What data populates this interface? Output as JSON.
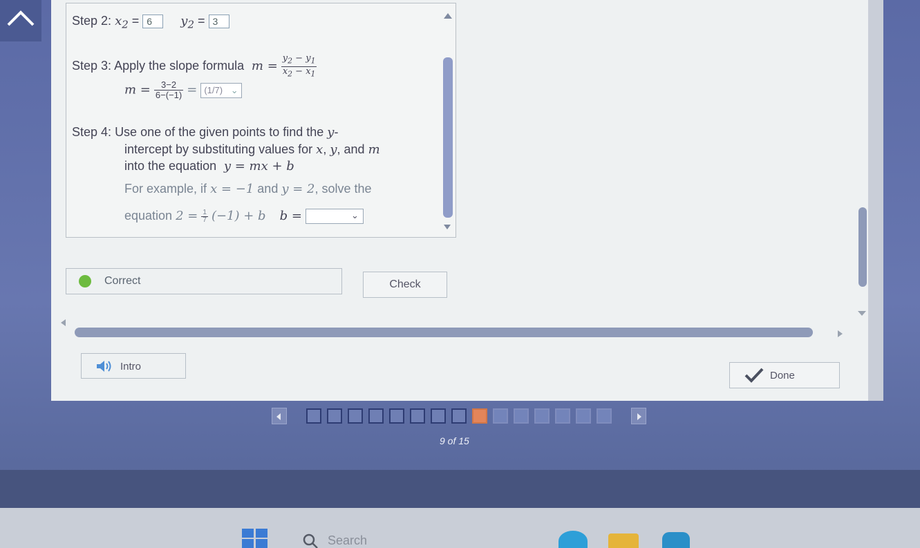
{
  "step2": {
    "label": "Step 2:",
    "x2_value": "6",
    "y2_value": "3"
  },
  "step3": {
    "label": "Step 3:",
    "text": "Apply the slope formula",
    "calc_num": "3−2",
    "calc_den": "6−(−1)",
    "answer_dropdown": "(1/7)"
  },
  "step4": {
    "label": "Step 4:",
    "line1": "Use one of the given points to find the",
    "line1_var": "y",
    "line2": "intercept by substituting values for",
    "line3": "into the equation",
    "example_line": "For example, if",
    "example_x": "x = −1",
    "example_and": "and",
    "example_y": "y = 2",
    "example_solve": ", solve the",
    "equation_label": "equation",
    "b_label": "b ="
  },
  "feedback": {
    "status": "Correct",
    "check_label": "Check"
  },
  "nav": {
    "intro_label": "Intro",
    "done_label": "Done"
  },
  "pagination": {
    "current": 9,
    "total": 15,
    "label": "9 of 15"
  },
  "taskbar": {
    "search_placeholder": "Search"
  },
  "colors": {
    "accent": "#6877b0",
    "current_page": "#e3855a",
    "correct_dot": "#6dbb3f"
  }
}
